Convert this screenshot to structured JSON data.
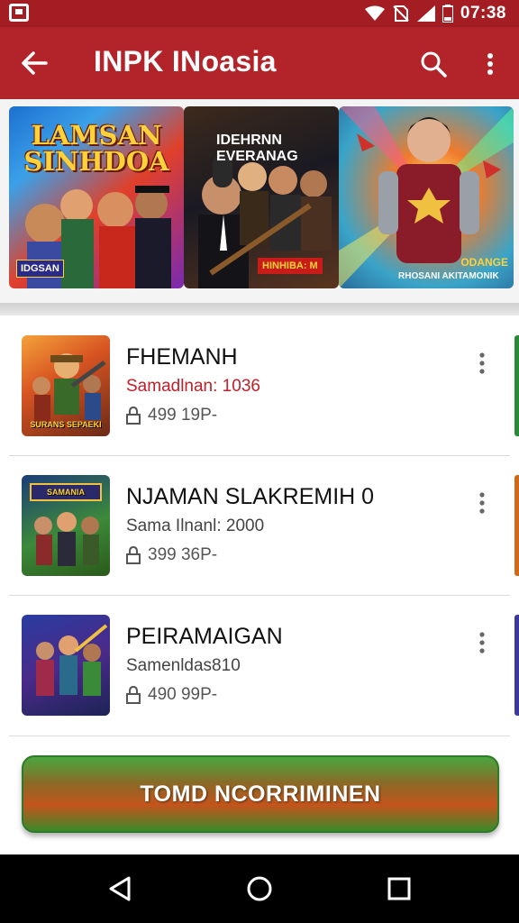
{
  "status_bar": {
    "time": "07:38",
    "icons": [
      "notification-icon",
      "wifi-icon",
      "no-sim-icon",
      "signal-icon",
      "battery-icon"
    ]
  },
  "app_bar": {
    "title": "INPK INoasia",
    "icons": [
      "back-arrow-icon",
      "search-icon",
      "more-vert-icon"
    ]
  },
  "banner": {
    "cards": [
      {
        "title_line1": "LAMSAN",
        "title_line2": "SINHDOA",
        "tag": "IDGSAN"
      },
      {
        "title_line1": "IDEHRNN",
        "title_line2": "EVERANAG",
        "tag": "HINHIBA: M"
      },
      {
        "tag": "RHOSANI AKITAMONIK",
        "tag_2": "ODANGE"
      }
    ]
  },
  "games": [
    {
      "title": "FHEMANH",
      "subtitle": "Samadlnan: 1036",
      "price": "499 19P-",
      "thumb_label": "SURANS SEPAEKI",
      "icon": "lock-icon"
    },
    {
      "title": "NJAMAN SLAKREMIH 0",
      "subtitle": "Sama Ilnanl: 2000",
      "price": "399 36P-",
      "thumb_label": "SAMANIA",
      "icon": "lock-icon"
    },
    {
      "title": "PEIRAMAIGAN",
      "subtitle": "Samenldas810",
      "price": "490 99P-",
      "thumb_label": "",
      "icon": "lock-icon"
    }
  ],
  "cta": {
    "label": "TOMD NCORRIMINEN"
  },
  "nav_bar": {
    "icons": [
      "nav-back-icon",
      "nav-home-icon",
      "nav-recents-icon"
    ]
  },
  "colors": {
    "app_bar": "#b3242a",
    "status_bar": "#a31d22",
    "accent_text": "#c0202a",
    "cta_green": "#4aa640",
    "cta_orange": "#c4541c"
  }
}
